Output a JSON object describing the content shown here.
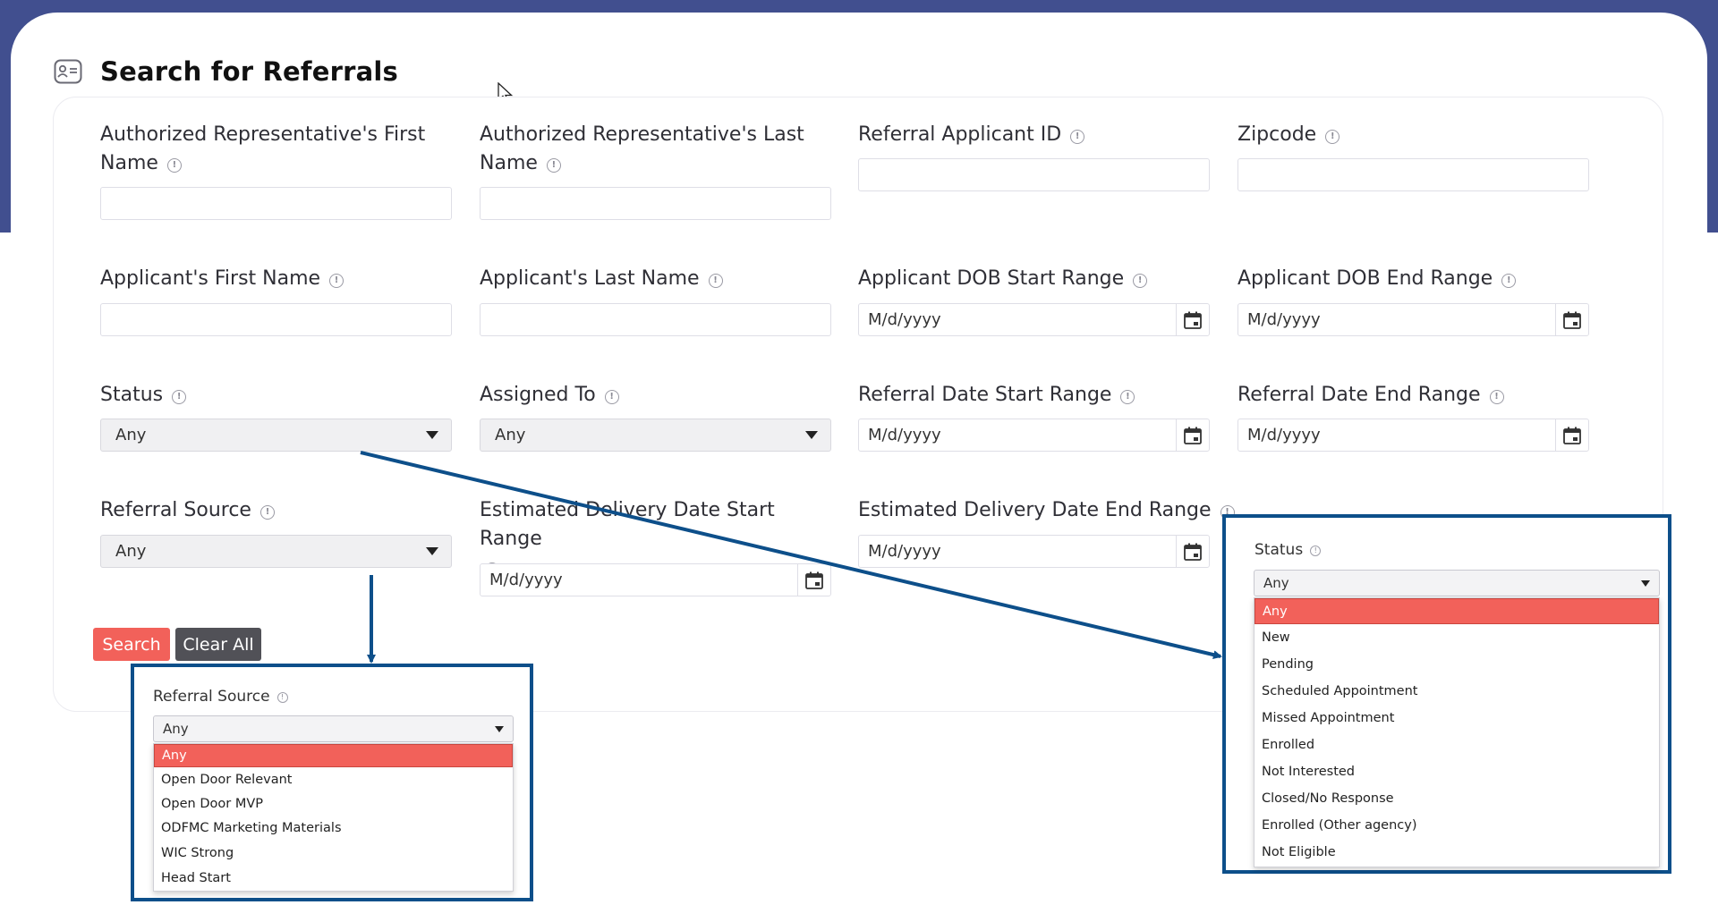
{
  "page": {
    "title": "Search for Referrals"
  },
  "fields": {
    "auth_rep_first": {
      "label_line1": "Authorized Representative's First",
      "label_line2": "Name",
      "value": ""
    },
    "auth_rep_last": {
      "label_line1": "Authorized Representative's Last",
      "label_line2": "Name",
      "value": ""
    },
    "referral_applicant_id": {
      "label": "Referral Applicant ID",
      "value": ""
    },
    "zipcode": {
      "label": "Zipcode",
      "value": ""
    },
    "applicant_first": {
      "label": "Applicant's First Name",
      "value": ""
    },
    "applicant_last": {
      "label": "Applicant's Last Name",
      "value": ""
    },
    "dob_start": {
      "label": "Applicant DOB Start Range",
      "placeholder": "M/d/yyyy"
    },
    "dob_end": {
      "label": "Applicant DOB End Range",
      "placeholder": "M/d/yyyy"
    },
    "status": {
      "label": "Status",
      "value": "Any"
    },
    "assigned_to": {
      "label": "Assigned To",
      "value": "Any"
    },
    "referral_date_start": {
      "label": "Referral Date Start Range",
      "placeholder": "M/d/yyyy"
    },
    "referral_date_end": {
      "label": "Referral Date End Range",
      "placeholder": "M/d/yyyy"
    },
    "referral_source": {
      "label": "Referral Source",
      "value": "Any"
    },
    "est_delivery_start": {
      "label": "Estimated Delivery Date Start Range",
      "placeholder": "M/d/yyyy"
    },
    "est_delivery_end": {
      "label": "Estimated Delivery Date End Range",
      "placeholder": "M/d/yyyy"
    }
  },
  "buttons": {
    "search": "Search",
    "clear_all": "Clear All"
  },
  "referral_source_zoom": {
    "label": "Referral Source",
    "selected": "Any",
    "options": [
      "Any",
      "Open Door Relevant",
      "Open Door MVP",
      "ODFMC Marketing Materials",
      "WIC Strong",
      "Head Start"
    ]
  },
  "status_zoom": {
    "label": "Status",
    "selected": "Any",
    "options": [
      "Any",
      "New",
      "Pending",
      "Scheduled Appointment",
      "Missed Appointment",
      "Enrolled",
      "Not Interested",
      "Closed/No Response",
      "Enrolled (Other agency)",
      "Not Eligible"
    ]
  },
  "colors": {
    "header_band": "#414f8f",
    "accent": "#f2615a",
    "clear_button": "#515157",
    "callout_border": "#0d4f8a"
  },
  "icons": {
    "title": "contact-card-icon",
    "info": "info-icon",
    "calendar": "calendar-icon",
    "dropdown": "caret-down-icon",
    "cursor": "mouse-pointer-icon"
  }
}
